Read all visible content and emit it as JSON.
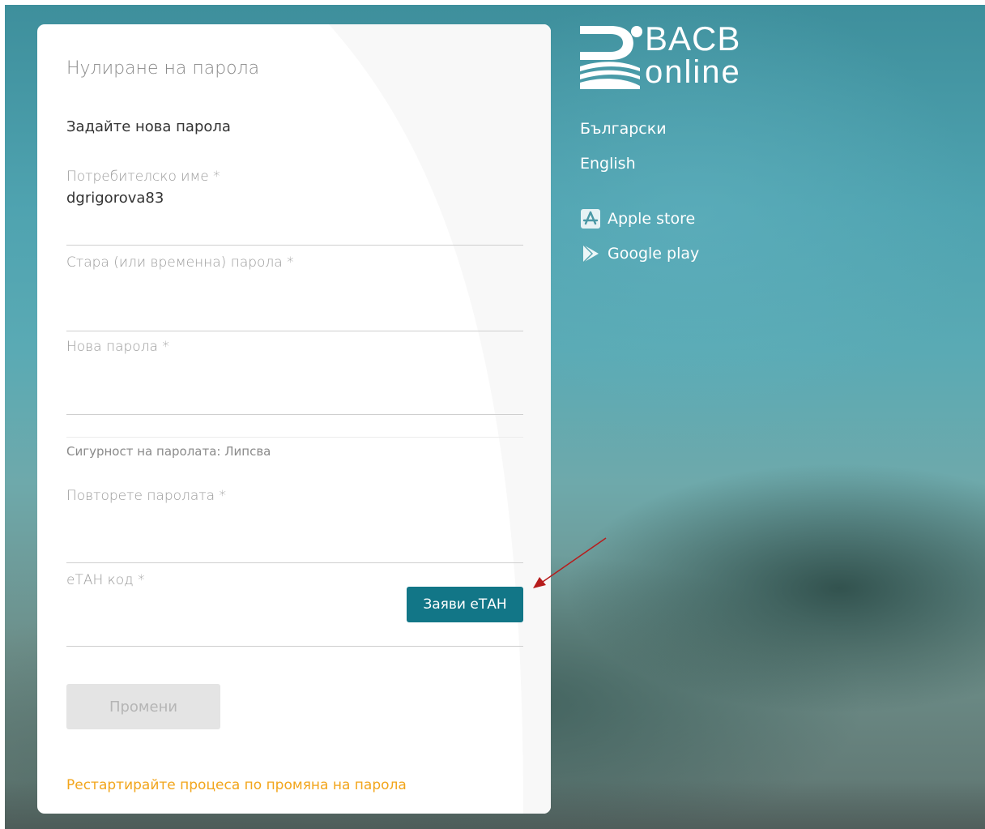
{
  "form": {
    "title": "Нулиране на парола",
    "subtitle": "Задайте нова парола",
    "username_label": "Потребителско име *",
    "username_value": "dgrigorova83",
    "old_password_label": "Стара (или временна) парола *",
    "new_password_label": "Нова парола *",
    "strength_text": "Сигурност на паролата: Липсва",
    "repeat_password_label": "Повторете паролата *",
    "etan_label": "еТАН код *",
    "etan_button": "Заяви еТАН",
    "submit_button": "Промени",
    "restart_link": "Рестартирайте процеса по промяна на парола"
  },
  "brand": {
    "line1": "BACB",
    "line2": "online"
  },
  "languages": {
    "bulgarian": "Български",
    "english": "English"
  },
  "stores": {
    "apple": "Apple store",
    "google": "Google play"
  },
  "colors": {
    "accent": "#127687",
    "link": "#f2a51b",
    "annotation_arrow": "#b71c1c"
  }
}
